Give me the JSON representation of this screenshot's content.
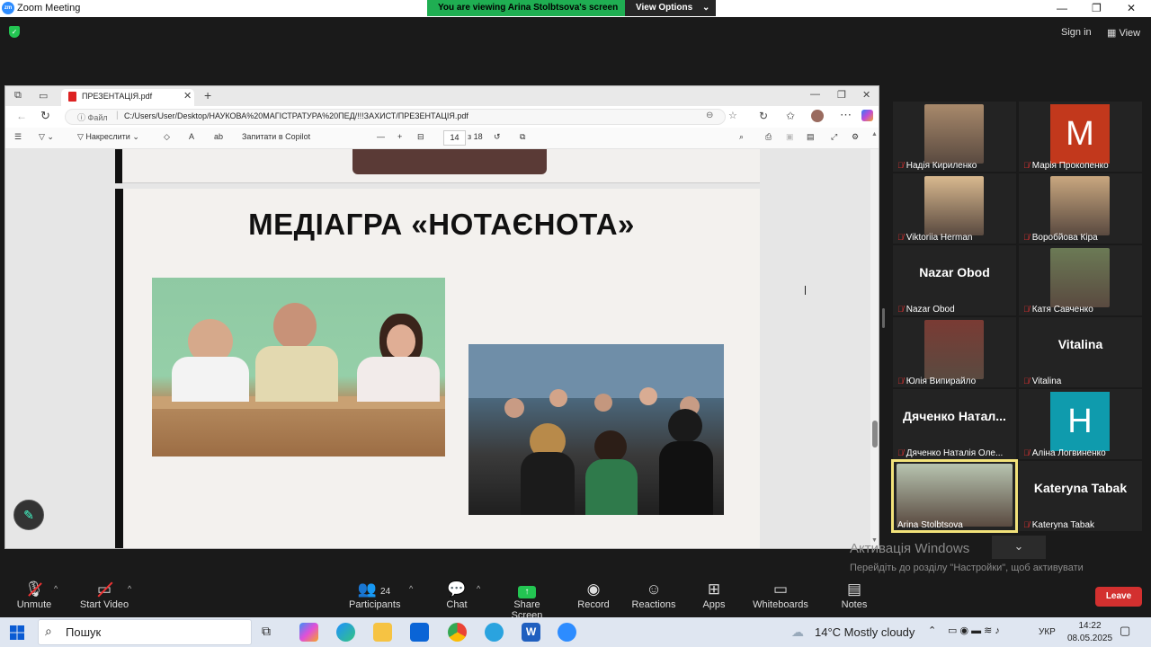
{
  "zoom": {
    "window_title": "Zoom Meeting",
    "banner_text": "You are viewing Arina Stolbtsova's screen",
    "view_options": "View Options",
    "sign_in": "Sign in",
    "view": "View"
  },
  "browser": {
    "tab_title": "ПРЕЗЕНТАЦІЯ.pdf",
    "addr_prefix": "Файл",
    "url": "C:/Users/User/Desktop/НАУКОВА%20МАГІСТРАТУРА%20ПЕД/!!!ЗАХИСТ/ПРЕЗЕНТАЦІЯ.pdf",
    "draw_label": "Накреслити",
    "copilot_label": "Запитати в Copilot",
    "page_current": "14",
    "page_total": "з 18"
  },
  "slide": {
    "title": "МЕДІАГРА «НОТАЄНОТА»"
  },
  "gallery": [
    {
      "name": "Надія Кириленко",
      "kind": "face",
      "color": "#a8896b",
      "muted": true
    },
    {
      "name": "Марія Прокопенко",
      "kind": "initial",
      "initial": "M",
      "color": "#c2381c",
      "muted": true
    },
    {
      "name": "Viktoriia Herman",
      "kind": "face",
      "color": "#d9b98f",
      "muted": true
    },
    {
      "name": "Воробйова Кіра",
      "kind": "face",
      "color": "#c9a77f",
      "muted": true
    },
    {
      "name": "Nazar Obod",
      "kind": "text",
      "display": "Nazar Obod",
      "muted": true
    },
    {
      "name": "Катя Савченко",
      "kind": "face",
      "color": "#6b7a55",
      "muted": true
    },
    {
      "name": "Юлія Випирайло",
      "kind": "face",
      "color": "#7a3b34",
      "muted": true
    },
    {
      "name": "Vitalina",
      "kind": "text",
      "display": "Vitalina",
      "muted": true
    },
    {
      "name": "Дяченко Наталія Оле...",
      "kind": "text",
      "display": "Дяченко Натал...",
      "muted": true
    },
    {
      "name": "Аліна Логвиненко",
      "kind": "initial",
      "initial": "H",
      "color": "#0f9bad",
      "muted": true
    },
    {
      "name": "Arina Stolbtsova",
      "kind": "face",
      "color": "#b7c4b0",
      "muted": false,
      "active": true
    },
    {
      "name": "Kateryna Tabak",
      "kind": "text",
      "display": "Kateryna Tabak",
      "muted": true
    }
  ],
  "activation": {
    "title": "Активація Windows",
    "subtitle": "Перейдіть до розділу \"Настройки\", щоб активувати Windows."
  },
  "toolbar": {
    "unmute": "Unmute",
    "start_video": "Start Video",
    "participants": "Participants",
    "participants_count": "24",
    "chat": "Chat",
    "share_screen": "Share Screen",
    "record": "Record",
    "reactions": "Reactions",
    "apps": "Apps",
    "whiteboards": "Whiteboards",
    "notes": "Notes",
    "leave": "Leave"
  },
  "taskbar": {
    "search": "Пошук",
    "weather": "14°C  Mostly cloudy",
    "lang": "УКР",
    "time": "14:22",
    "date": "08.05.2025"
  },
  "colors": {
    "zoom_green": "#1fae52",
    "leave_red": "#d3302f",
    "active_border": "#f2e27a"
  }
}
